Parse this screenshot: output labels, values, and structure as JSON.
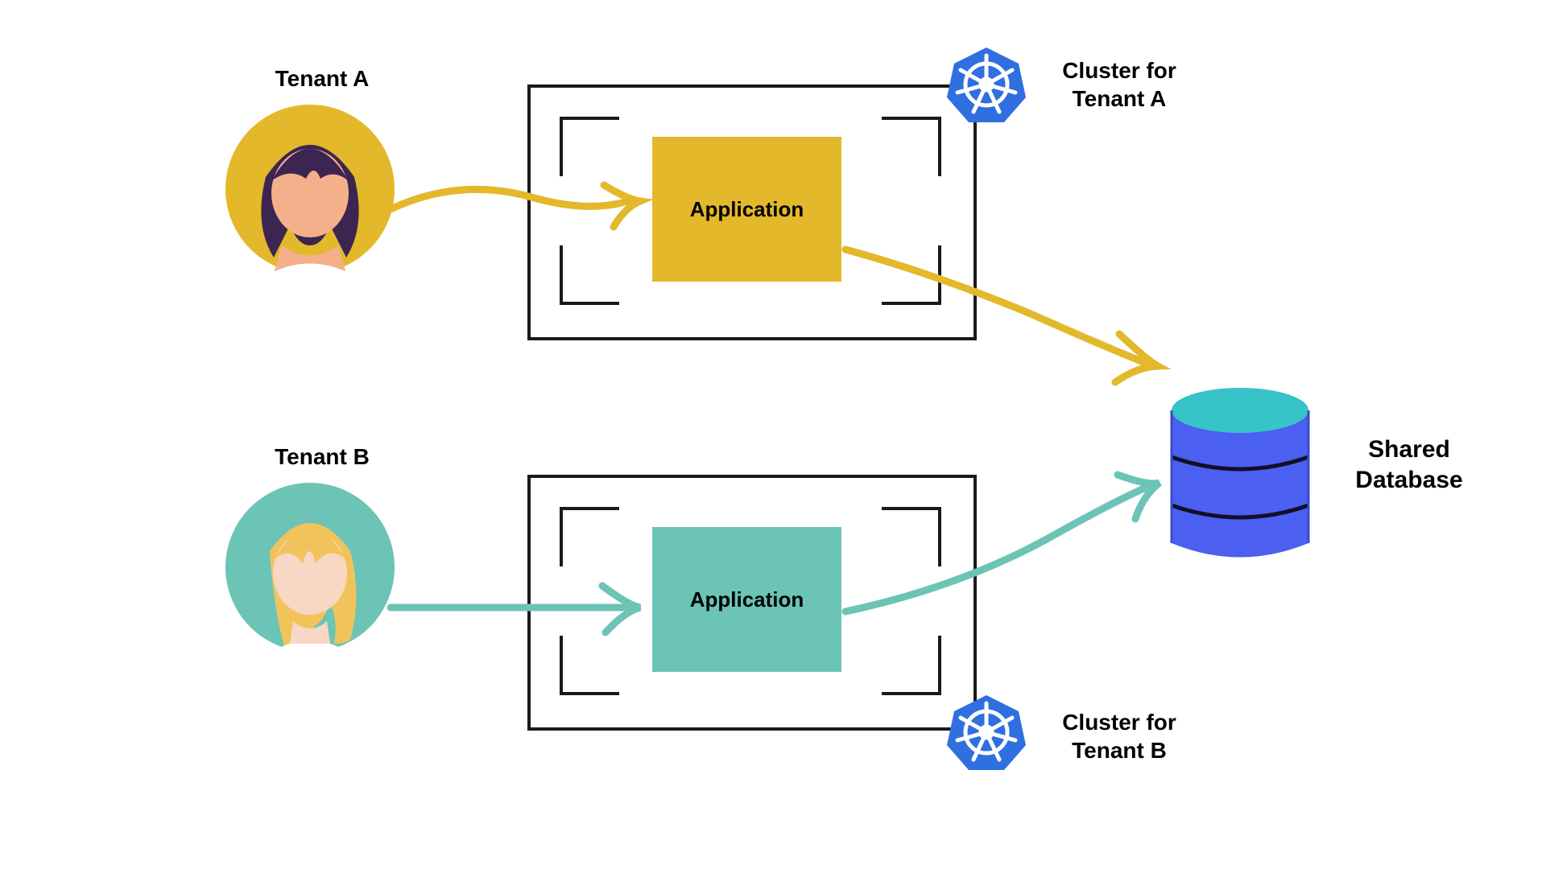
{
  "tenantA": {
    "label": "Tenant  A",
    "appLabel": "Application",
    "clusterLabel": "Cluster for\nTenant A",
    "color": "#e3b82a"
  },
  "tenantB": {
    "label": "Tenant  B",
    "appLabel": "Application",
    "clusterLabel": "Cluster for\nTenant B",
    "color": "#6cc4b6"
  },
  "database": {
    "label": "Shared\nDatabase"
  },
  "icons": {
    "k8s": "kubernetes-icon",
    "db": "database-icon",
    "avatar": "user-avatar-icon"
  }
}
